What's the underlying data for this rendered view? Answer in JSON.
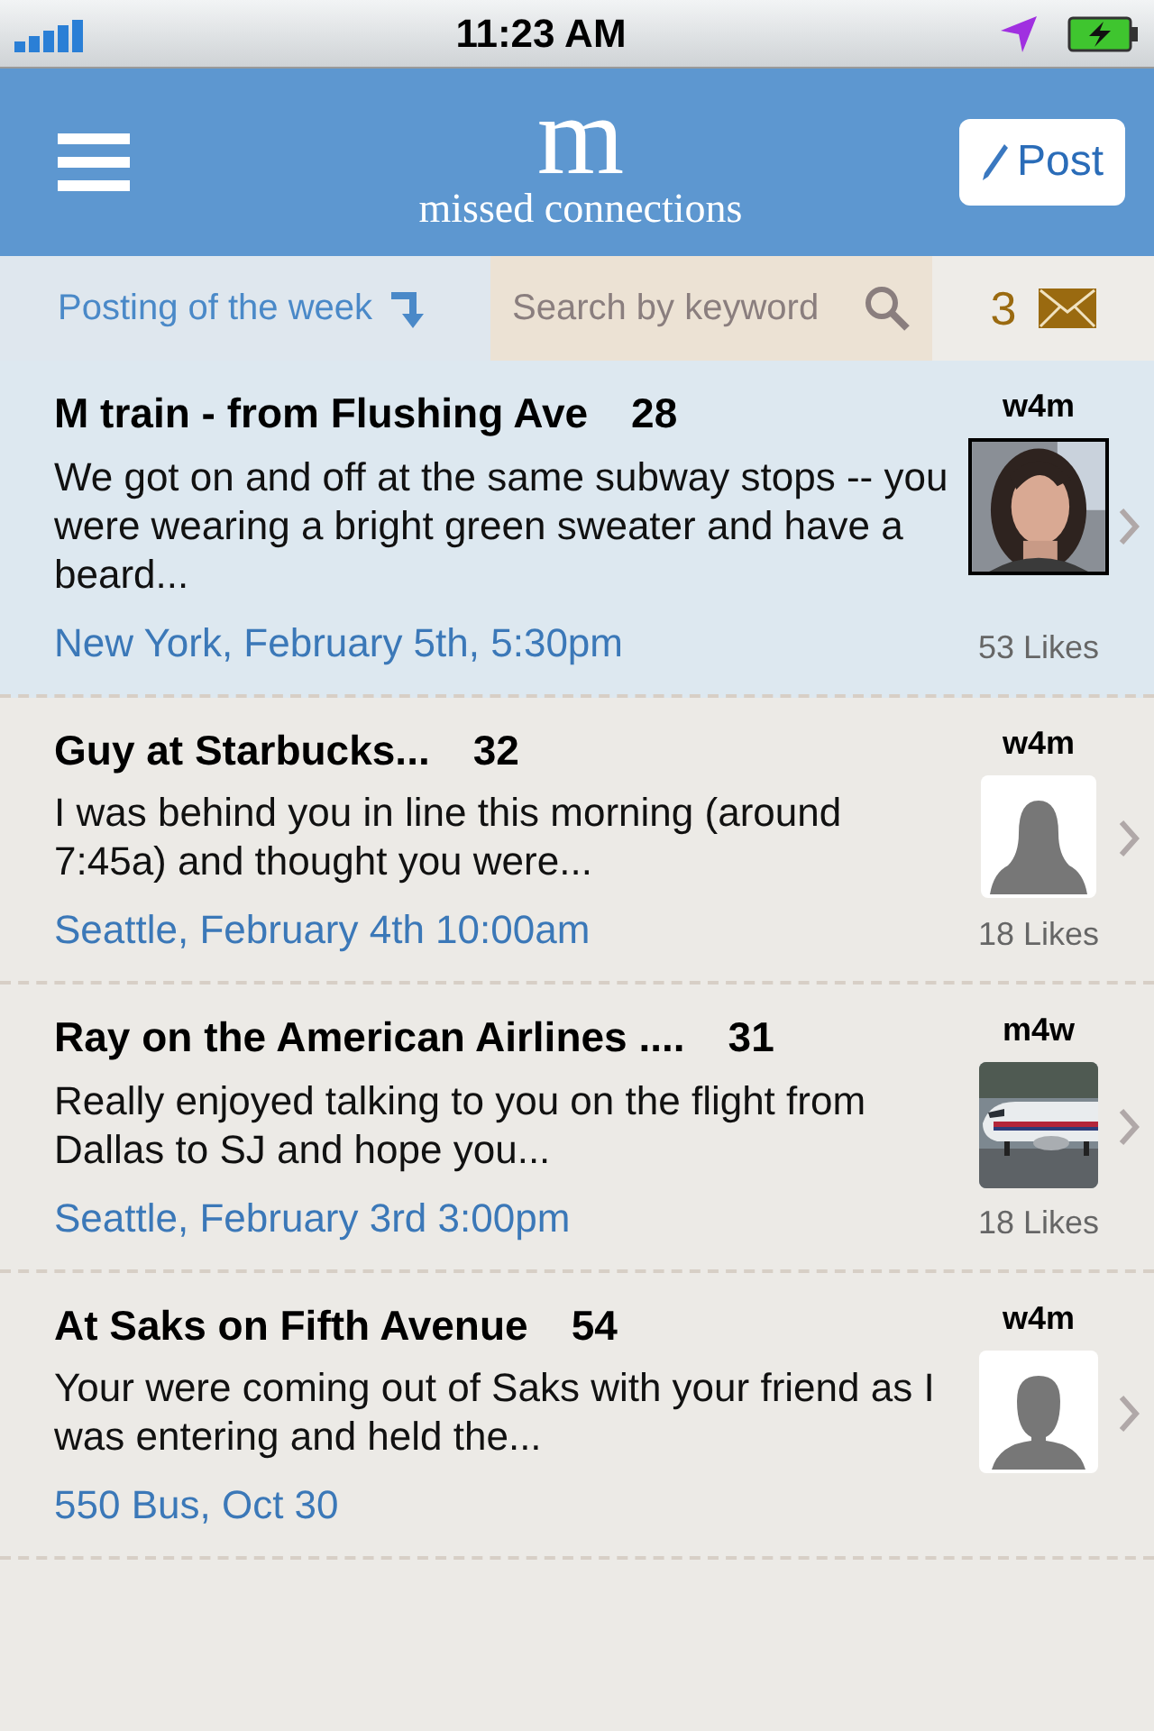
{
  "status_bar": {
    "time": "11:23 AM"
  },
  "header": {
    "logo": "m",
    "subtitle": "missed connections",
    "post_button": "Post"
  },
  "toolbar": {
    "posting_of_week": "Posting of the week",
    "search": {
      "placeholder": "Search by keyword"
    },
    "message_count": "3"
  },
  "posts": [
    {
      "title": "M train - from Flushing Ave",
      "count": "28",
      "tag": "w4m",
      "body": "We got on and off at the same subway stops -- you were wearing a bright green sweater and have a beard...",
      "location": "New York, February 5th,  5:30pm",
      "likes": "53 Likes",
      "featured": true,
      "thumb": {
        "kind": "portrait"
      }
    },
    {
      "title": "Guy at Starbucks...",
      "count": "32",
      "tag": "w4m",
      "body": "I was behind you in line this morning (around 7:45a) and thought you were...",
      "location": "Seattle, February 4th  10:00am",
      "likes": "18 Likes",
      "featured": false,
      "thumb": {
        "kind": "female"
      }
    },
    {
      "title": "Ray on the American Airlines ....",
      "count": "31",
      "tag": "m4w",
      "body": "Really enjoyed talking to you on the flight from Dallas to SJ and hope you...",
      "location": "Seattle, February 3rd  3:00pm",
      "likes": "18 Likes",
      "featured": false,
      "thumb": {
        "kind": "airplane"
      }
    },
    {
      "title": "At Saks on Fifth Avenue",
      "count": "54",
      "tag": "w4m",
      "body": "Your were coming out of Saks with your friend as I was entering and held the...",
      "location": "550 Bus, Oct 30",
      "featured": false,
      "thumb": {
        "kind": "male"
      }
    }
  ]
}
